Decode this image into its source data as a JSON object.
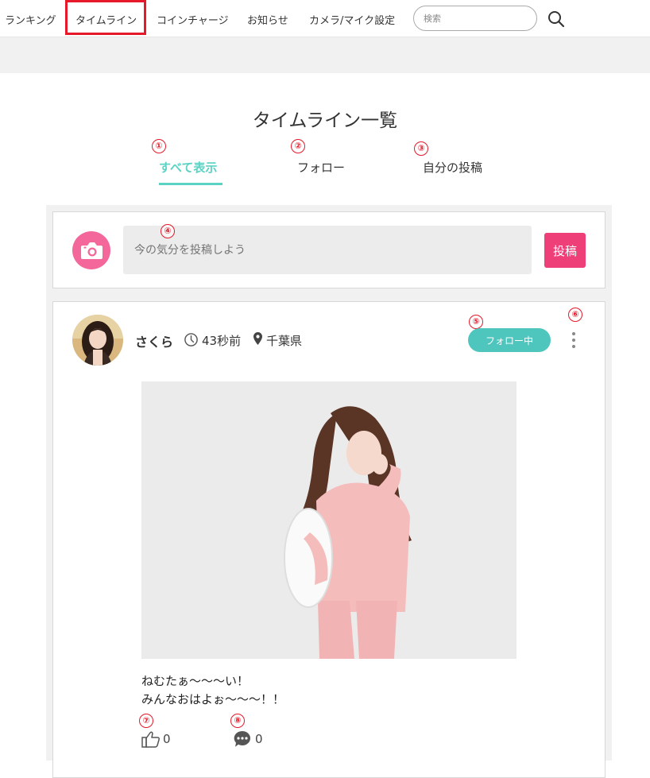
{
  "nav": {
    "items": [
      {
        "label": "ランキング"
      },
      {
        "label": "タイムライン"
      },
      {
        "label": "コインチャージ"
      },
      {
        "label": "お知らせ"
      },
      {
        "label": "カメラ/マイク設定"
      }
    ],
    "search_placeholder": "検索",
    "highlight_color": "#e6192b"
  },
  "page": {
    "title": "タイムライン一覧"
  },
  "tabs": [
    {
      "label": "すべて表示",
      "active": true
    },
    {
      "label": "フォロー",
      "active": false
    },
    {
      "label": "自分の投稿",
      "active": false
    }
  ],
  "annotations": [
    "①",
    "②",
    "③",
    "④",
    "⑤",
    "⑥",
    "⑦",
    "⑧"
  ],
  "composer": {
    "placeholder": "今の気分を投稿しよう",
    "post_label": "投稿"
  },
  "post": {
    "username": "さくら",
    "time": "43秒前",
    "location": "千葉県",
    "follow_label": "フォロー中",
    "text_lines": [
      "ねむたぁ〜〜〜い！",
      "みんなおはよぉ〜〜〜！！"
    ],
    "likes": "0",
    "comments": "0"
  },
  "colors": {
    "accent_teal": "#5bd3c4",
    "follow_button": "#4ec5bd",
    "post_button": "#ef3f78",
    "camera_button": "#f4679a",
    "annotation_red": "#e6192b"
  }
}
